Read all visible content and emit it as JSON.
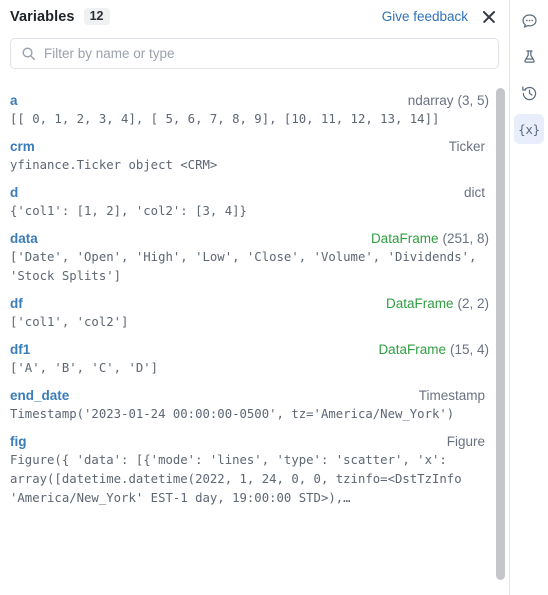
{
  "header": {
    "title": "Variables",
    "count": "12",
    "feedback_label": "Give feedback",
    "close_icon": "close-icon"
  },
  "search": {
    "placeholder": "Filter by name or type",
    "value": "",
    "icon": "search-icon"
  },
  "variables": [
    {
      "name": "a",
      "type": "ndarray",
      "type_color": "gray",
      "shape": "(3, 5)",
      "value": "[[ 0, 1, 2, 3, 4], [ 5, 6, 7, 8, 9], [10, 11, 12, 13, 14]]"
    },
    {
      "name": "crm",
      "type": "Ticker",
      "type_color": "gray",
      "shape": "",
      "value": "yfinance.Ticker object <CRM>"
    },
    {
      "name": "d",
      "type": "dict",
      "type_color": "gray",
      "shape": "",
      "value": "{'col1': [1, 2], 'col2': [3, 4]}"
    },
    {
      "name": "data",
      "type": "DataFrame",
      "type_color": "green",
      "shape": "(251, 8)",
      "value": "['Date', 'Open', 'High', 'Low', 'Close', 'Volume', 'Dividends', 'Stock Splits']"
    },
    {
      "name": "df",
      "type": "DataFrame",
      "type_color": "green",
      "shape": "(2, 2)",
      "value": "['col1', 'col2']"
    },
    {
      "name": "df1",
      "type": "DataFrame",
      "type_color": "green",
      "shape": "(15, 4)",
      "value": "['A', 'B', 'C', 'D']"
    },
    {
      "name": "end_date",
      "type": "Timestamp",
      "type_color": "gray",
      "shape": "",
      "value": "Timestamp('2023-01-24 00:00:00-0500', tz='America/New_York')"
    },
    {
      "name": "fig",
      "type": "Figure",
      "type_color": "gray",
      "shape": "",
      "value": "Figure({ 'data': [{'mode': 'lines', 'type': 'scatter', 'x': array([datetime.datetime(2022, 1, 24, 0, 0, tzinfo=<DstTzInfo 'America/New_York' EST-1 day, 19:00:00 STD>),…"
    }
  ],
  "rail": {
    "items": [
      {
        "icon": "comment-bubble-icon",
        "active": false
      },
      {
        "icon": "flask-icon",
        "active": false
      },
      {
        "icon": "history-clock-icon",
        "active": false
      },
      {
        "icon": "variables-braces-icon",
        "label": "{x}",
        "active": true
      }
    ]
  },
  "colors": {
    "name_blue": "#3a7cb8",
    "type_green": "#2f9e41",
    "type_gray": "#6a7180",
    "link_blue": "#2f72b8",
    "value_gray": "#5d6673",
    "active_bg": "#e8eefb"
  }
}
